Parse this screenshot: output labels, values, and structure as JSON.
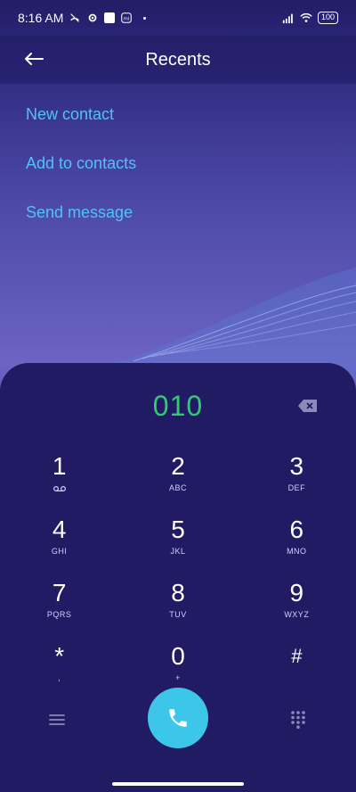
{
  "status_bar": {
    "time": "8:16 AM",
    "battery": "100",
    "icons": [
      "missed-call-icon",
      "settings-icon",
      "square-icon",
      "mi-icon",
      "dot-icon",
      "signal-icon",
      "wifi-icon",
      "battery-icon"
    ]
  },
  "header": {
    "title": "Recents",
    "back_icon": "back-arrow-icon"
  },
  "actions": [
    {
      "label": "New contact"
    },
    {
      "label": "Add to contacts"
    },
    {
      "label": "Send message"
    }
  ],
  "dialer": {
    "number": "010",
    "accent_color": "#2ecc71",
    "call_button_color": "#3cc6ea",
    "keys": [
      [
        {
          "digit": "1",
          "letters": ""
        },
        {
          "digit": "2",
          "letters": "ABC"
        },
        {
          "digit": "3",
          "letters": "DEF"
        }
      ],
      [
        {
          "digit": "4",
          "letters": "GHI"
        },
        {
          "digit": "5",
          "letters": "JKL"
        },
        {
          "digit": "6",
          "letters": "MNO"
        }
      ],
      [
        {
          "digit": "7",
          "letters": "PQRS"
        },
        {
          "digit": "8",
          "letters": "TUV"
        },
        {
          "digit": "9",
          "letters": "WXYZ"
        }
      ],
      [
        {
          "digit": "*",
          "letters": ","
        },
        {
          "digit": "0",
          "letters": "+"
        },
        {
          "digit": "#",
          "letters": ""
        }
      ]
    ]
  }
}
